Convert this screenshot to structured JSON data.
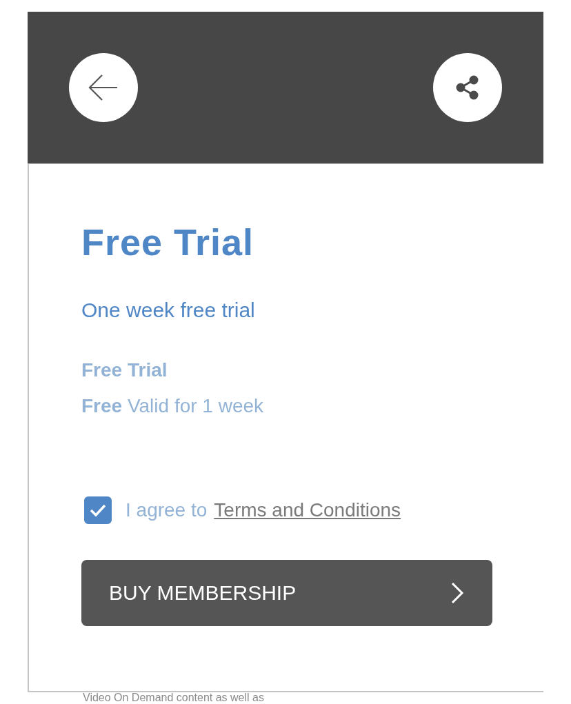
{
  "plan": {
    "title": "Free Trial",
    "description": "One week free trial",
    "name": "Free Trial",
    "price_line": "**Free** Valid for 1 week"
  },
  "agreement": {
    "checked": true,
    "text": "I agree to",
    "link": "Terms and Conditions"
  },
  "buy_button": {
    "label": "BUY MEMBERSHIP"
  },
  "content_below": "Video On Demand content as well as"
}
